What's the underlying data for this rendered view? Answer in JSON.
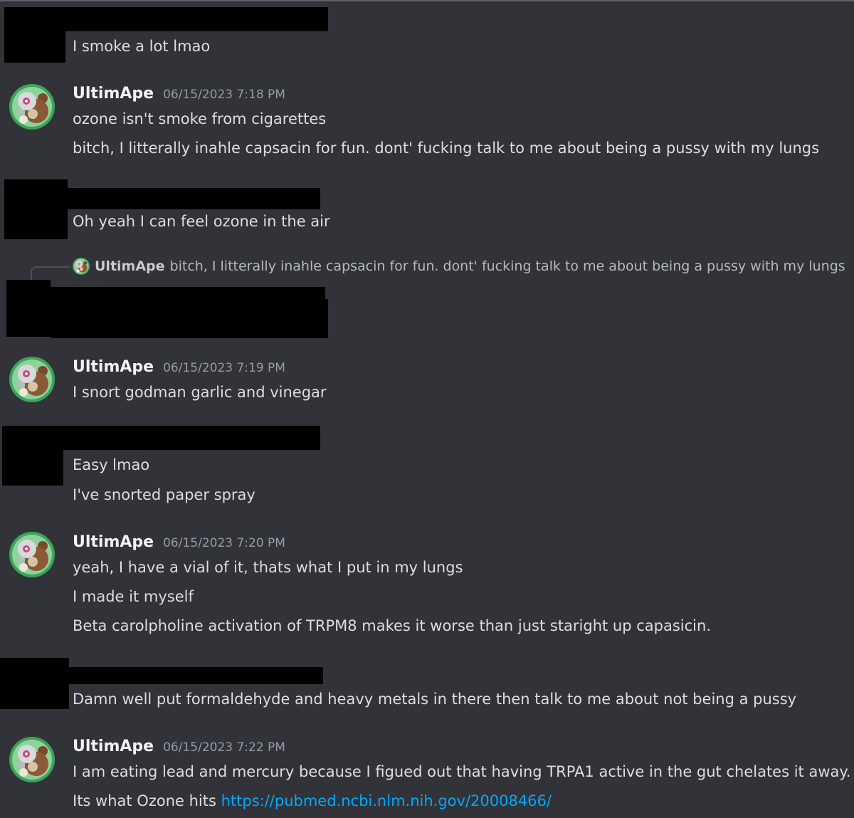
{
  "author": "UltimApe",
  "messages": [
    {
      "id": "m1",
      "lines": [
        "I smoke a lot lmao"
      ]
    },
    {
      "id": "m2",
      "timestamp": "06/15/2023 7:18 PM",
      "lines": [
        "ozone isn't smoke from cigarettes",
        "bitch, I litterally inahle capsacin for fun. dont' fucking talk to me about being a pussy with my lungs"
      ]
    },
    {
      "id": "m3",
      "lines": [
        "Oh yeah I can feel ozone in the air"
      ]
    },
    {
      "id": "m4",
      "reply": {
        "author": "UltimApe",
        "text": "bitch, I litterally inahle capsacin for fun. dont' fucking talk to me about being a pussy with my lungs"
      }
    },
    {
      "id": "m5",
      "timestamp": "06/15/2023 7:19 PM",
      "lines": [
        "I snort godman garlic and vinegar"
      ]
    },
    {
      "id": "m6",
      "lines": [
        "Easy lmao",
        "I've snorted paper spray"
      ]
    },
    {
      "id": "m7",
      "timestamp": "06/15/2023 7:20 PM",
      "lines": [
        "yeah, I have a vial of it, thats what I put in my lungs",
        "I made it myself",
        "Beta carolpholine activation of TRPM8 makes it worse than just staright up capasicin."
      ]
    },
    {
      "id": "m8",
      "lines": [
        "Damn well put formaldehyde and heavy metals in there then talk to me about not being a pussy"
      ]
    },
    {
      "id": "m9",
      "timestamp": "06/15/2023 7:22 PM",
      "lines": [
        "I am eating lead and mercury because I figued out that having TRPA1 active in the gut chelates it away."
      ],
      "last_line_prefix": "Its what Ozone hits ",
      "link": "https://pubmed.ncbi.nlm.nih.gov/20008466/"
    }
  ],
  "colors": {
    "background": "#313338",
    "text": "#dbdee1",
    "timestamp": "#949ba4",
    "link": "#00a8fc",
    "redaction": "#000000",
    "avatar_bg": "#3ba55c"
  },
  "icons": {
    "avatar": "bear-robot-avatar-icon"
  }
}
